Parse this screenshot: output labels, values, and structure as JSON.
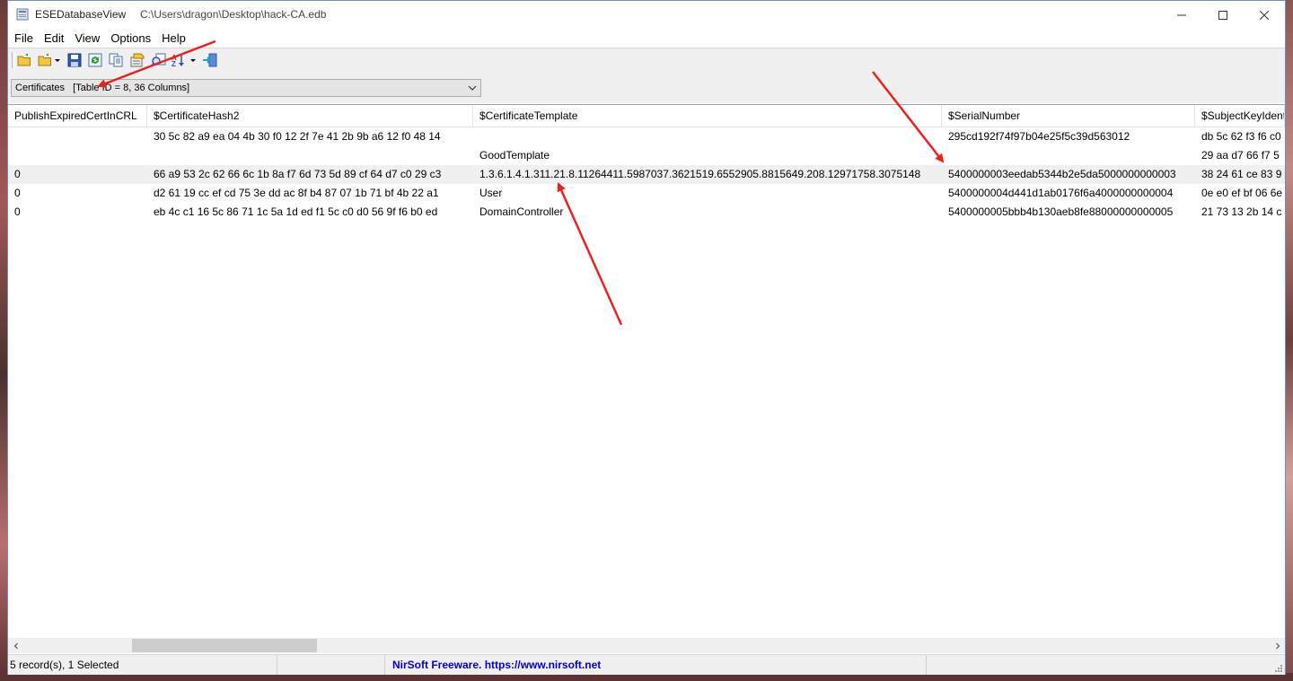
{
  "window": {
    "app_name": "ESEDatabaseView",
    "file_path": "C:\\Users\\dragon\\Desktop\\hack-CA.edb",
    "minimize_icon": "minimize-icon",
    "maximize_icon": "maximize-icon",
    "close_icon": "close-icon"
  },
  "menu": [
    "File",
    "Edit",
    "View",
    "Options",
    "Help"
  ],
  "toolbar": {
    "icons": [
      "open-folder-icon",
      "open-dropdown-icon",
      "save-icon",
      "refresh-icon",
      "copy-icon",
      "properties-icon",
      "find-icon",
      "sort-icon",
      "exit-icon"
    ]
  },
  "table_selector": {
    "value": "Certificates   [Table ID = 8, 36 Columns]"
  },
  "grid": {
    "columns": [
      "PublishExpiredCertInCRL",
      "$CertificateHash2",
      "$CertificateTemplate",
      "$SerialNumber",
      "$SubjectKeyIdentifier"
    ],
    "rows": [
      [
        "",
        "30 5c 82 a9 ea 04 4b 30 f0 12 2f 7e 41 2b 9b a6 12 f0 48 14",
        "",
        "295cd192f74f97b04e25f5c39d563012",
        "db 5c 62 f3 f6 c0"
      ],
      [
        "",
        "",
        "GoodTemplate",
        "",
        "29 aa d7 66 f7 5"
      ],
      [
        "0",
        "66 a9 53 2c 62 66 6c 1b 8a f7 6d 73 5d 89 cf 64 d7 c0 29 c3",
        "1.3.6.1.4.1.311.21.8.11264411.5987037.3621519.6552905.8815649.208.12971758.3075148",
        "5400000003eedab5344b2e5da5000000000003",
        "38 24 61 ce 83 9"
      ],
      [
        "0",
        "d2 61 19 cc ef cd 75 3e dd ac 8f b4 87 07 1b 71 bf 4b 22 a1",
        "User",
        "5400000004d441d1ab0176f6a4000000000004",
        "0e e0 ef bf 06 6e"
      ],
      [
        "0",
        "eb 4c c1 16 5c 86 71 1c 5a 1d ed f1 5c c0 d0 56 9f f6 b0 ed",
        "DomainController",
        "5400000005bbb4b130aeb8fe88000000000005",
        "21 73 13 2b 14 c"
      ]
    ],
    "selected_row": 2
  },
  "status": {
    "records": "5 record(s), 1 Selected",
    "credit": "NirSoft Freeware. https://www.nirsoft.net"
  },
  "colors": {
    "annotation_arrow": "#e8231f",
    "link": "#0000c8",
    "selected_row": "#f0f0f0"
  }
}
